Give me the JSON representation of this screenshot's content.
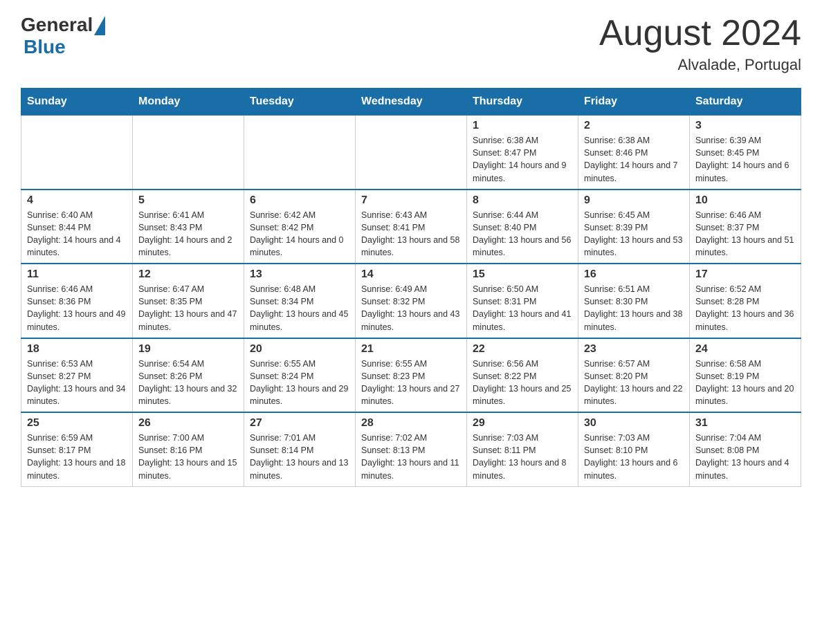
{
  "header": {
    "logo_general": "General",
    "logo_blue": "Blue",
    "month_title": "August 2024",
    "location": "Alvalade, Portugal"
  },
  "days_of_week": [
    "Sunday",
    "Monday",
    "Tuesday",
    "Wednesday",
    "Thursday",
    "Friday",
    "Saturday"
  ],
  "weeks": [
    [
      {
        "day": "",
        "info": ""
      },
      {
        "day": "",
        "info": ""
      },
      {
        "day": "",
        "info": ""
      },
      {
        "day": "",
        "info": ""
      },
      {
        "day": "1",
        "info": "Sunrise: 6:38 AM\nSunset: 8:47 PM\nDaylight: 14 hours and 9 minutes."
      },
      {
        "day": "2",
        "info": "Sunrise: 6:38 AM\nSunset: 8:46 PM\nDaylight: 14 hours and 7 minutes."
      },
      {
        "day": "3",
        "info": "Sunrise: 6:39 AM\nSunset: 8:45 PM\nDaylight: 14 hours and 6 minutes."
      }
    ],
    [
      {
        "day": "4",
        "info": "Sunrise: 6:40 AM\nSunset: 8:44 PM\nDaylight: 14 hours and 4 minutes."
      },
      {
        "day": "5",
        "info": "Sunrise: 6:41 AM\nSunset: 8:43 PM\nDaylight: 14 hours and 2 minutes."
      },
      {
        "day": "6",
        "info": "Sunrise: 6:42 AM\nSunset: 8:42 PM\nDaylight: 14 hours and 0 minutes."
      },
      {
        "day": "7",
        "info": "Sunrise: 6:43 AM\nSunset: 8:41 PM\nDaylight: 13 hours and 58 minutes."
      },
      {
        "day": "8",
        "info": "Sunrise: 6:44 AM\nSunset: 8:40 PM\nDaylight: 13 hours and 56 minutes."
      },
      {
        "day": "9",
        "info": "Sunrise: 6:45 AM\nSunset: 8:39 PM\nDaylight: 13 hours and 53 minutes."
      },
      {
        "day": "10",
        "info": "Sunrise: 6:46 AM\nSunset: 8:37 PM\nDaylight: 13 hours and 51 minutes."
      }
    ],
    [
      {
        "day": "11",
        "info": "Sunrise: 6:46 AM\nSunset: 8:36 PM\nDaylight: 13 hours and 49 minutes."
      },
      {
        "day": "12",
        "info": "Sunrise: 6:47 AM\nSunset: 8:35 PM\nDaylight: 13 hours and 47 minutes."
      },
      {
        "day": "13",
        "info": "Sunrise: 6:48 AM\nSunset: 8:34 PM\nDaylight: 13 hours and 45 minutes."
      },
      {
        "day": "14",
        "info": "Sunrise: 6:49 AM\nSunset: 8:32 PM\nDaylight: 13 hours and 43 minutes."
      },
      {
        "day": "15",
        "info": "Sunrise: 6:50 AM\nSunset: 8:31 PM\nDaylight: 13 hours and 41 minutes."
      },
      {
        "day": "16",
        "info": "Sunrise: 6:51 AM\nSunset: 8:30 PM\nDaylight: 13 hours and 38 minutes."
      },
      {
        "day": "17",
        "info": "Sunrise: 6:52 AM\nSunset: 8:28 PM\nDaylight: 13 hours and 36 minutes."
      }
    ],
    [
      {
        "day": "18",
        "info": "Sunrise: 6:53 AM\nSunset: 8:27 PM\nDaylight: 13 hours and 34 minutes."
      },
      {
        "day": "19",
        "info": "Sunrise: 6:54 AM\nSunset: 8:26 PM\nDaylight: 13 hours and 32 minutes."
      },
      {
        "day": "20",
        "info": "Sunrise: 6:55 AM\nSunset: 8:24 PM\nDaylight: 13 hours and 29 minutes."
      },
      {
        "day": "21",
        "info": "Sunrise: 6:55 AM\nSunset: 8:23 PM\nDaylight: 13 hours and 27 minutes."
      },
      {
        "day": "22",
        "info": "Sunrise: 6:56 AM\nSunset: 8:22 PM\nDaylight: 13 hours and 25 minutes."
      },
      {
        "day": "23",
        "info": "Sunrise: 6:57 AM\nSunset: 8:20 PM\nDaylight: 13 hours and 22 minutes."
      },
      {
        "day": "24",
        "info": "Sunrise: 6:58 AM\nSunset: 8:19 PM\nDaylight: 13 hours and 20 minutes."
      }
    ],
    [
      {
        "day": "25",
        "info": "Sunrise: 6:59 AM\nSunset: 8:17 PM\nDaylight: 13 hours and 18 minutes."
      },
      {
        "day": "26",
        "info": "Sunrise: 7:00 AM\nSunset: 8:16 PM\nDaylight: 13 hours and 15 minutes."
      },
      {
        "day": "27",
        "info": "Sunrise: 7:01 AM\nSunset: 8:14 PM\nDaylight: 13 hours and 13 minutes."
      },
      {
        "day": "28",
        "info": "Sunrise: 7:02 AM\nSunset: 8:13 PM\nDaylight: 13 hours and 11 minutes."
      },
      {
        "day": "29",
        "info": "Sunrise: 7:03 AM\nSunset: 8:11 PM\nDaylight: 13 hours and 8 minutes."
      },
      {
        "day": "30",
        "info": "Sunrise: 7:03 AM\nSunset: 8:10 PM\nDaylight: 13 hours and 6 minutes."
      },
      {
        "day": "31",
        "info": "Sunrise: 7:04 AM\nSunset: 8:08 PM\nDaylight: 13 hours and 4 minutes."
      }
    ]
  ]
}
